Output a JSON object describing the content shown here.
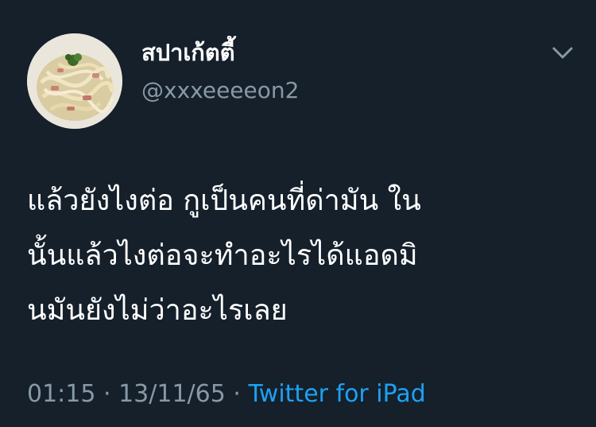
{
  "user": {
    "display_name": "สปาเก้ตตี้",
    "handle": "@xxxeeeeon2",
    "avatar_icon": "spaghetti-carbonara-photo"
  },
  "menu": {
    "icon": "chevron-down-icon"
  },
  "tweet": {
    "lines": [
      "แล้วยังไงต่อ กูเป็นคนที่ด่ามัน ใน",
      "นั้นแล้วไงต่อจะทำอะไรได้แอดมิ",
      "นมันยังไม่ว่าอะไรเลย"
    ]
  },
  "meta": {
    "time": "01:15",
    "separator1": " · ",
    "date": "13/11/65",
    "separator2": " · ",
    "source": "Twitter for iPad"
  },
  "colors": {
    "background": "#15202b",
    "text": "#ffffff",
    "secondary_text": "#8899a6",
    "link": "#1da1f2"
  }
}
